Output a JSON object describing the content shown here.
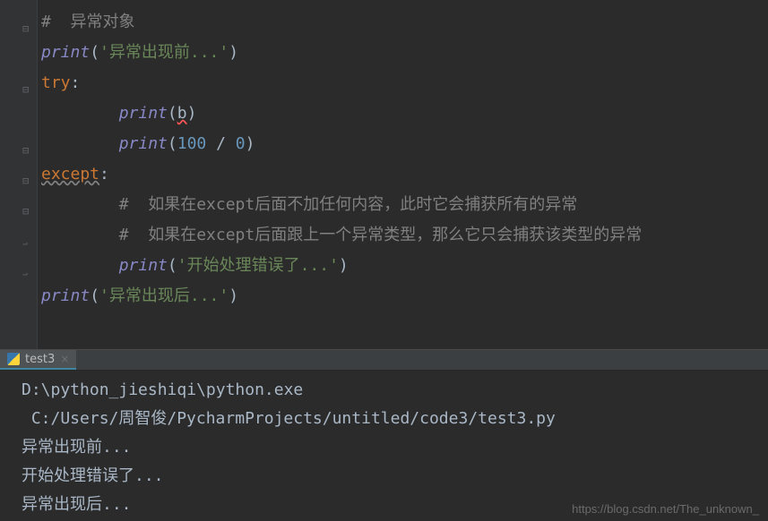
{
  "editor": {
    "lines": [
      {
        "gutter": "minus",
        "segments": [
          {
            "cls": "c-comment",
            "text": "#  异常对象"
          }
        ]
      },
      {
        "gutter": "",
        "segments": [
          {
            "cls": "c-builtin",
            "text": "print"
          },
          {
            "cls": "c-paren",
            "text": "("
          },
          {
            "cls": "c-string",
            "text": "'异常出现前...'"
          },
          {
            "cls": "c-paren",
            "text": ")"
          }
        ]
      },
      {
        "gutter": "minus",
        "segments": [
          {
            "cls": "c-keyword",
            "text": "try"
          },
          {
            "cls": "c-op",
            "text": ":"
          }
        ]
      },
      {
        "gutter": "",
        "indent": 2,
        "segments": [
          {
            "cls": "c-builtin",
            "text": "print"
          },
          {
            "cls": "c-paren",
            "text": "("
          },
          {
            "cls": "c-ident-err",
            "text": "b"
          },
          {
            "cls": "c-paren",
            "text": ")"
          }
        ]
      },
      {
        "gutter": "minus",
        "indent": 2,
        "segments": [
          {
            "cls": "c-builtin",
            "text": "print"
          },
          {
            "cls": "c-paren",
            "text": "("
          },
          {
            "cls": "c-number",
            "text": "100 "
          },
          {
            "cls": "c-op",
            "text": "/ "
          },
          {
            "cls": "c-number",
            "text": "0"
          },
          {
            "cls": "c-paren",
            "text": ")"
          }
        ]
      },
      {
        "gutter": "minus",
        "segments": [
          {
            "cls": "c-except",
            "text": "except"
          },
          {
            "cls": "c-op",
            "text": ":"
          }
        ]
      },
      {
        "gutter": "minus",
        "indent": 2,
        "segments": [
          {
            "cls": "c-comment",
            "text": "#  如果在except后面不加任何内容，此时它会捕获所有的异常"
          }
        ]
      },
      {
        "gutter": "end",
        "indent": 2,
        "segments": [
          {
            "cls": "c-comment",
            "text": "#  如果在except后面跟上一个异常类型，那么它只会捕获该类型的异常"
          }
        ]
      },
      {
        "gutter": "end",
        "indent": 2,
        "segments": [
          {
            "cls": "c-builtin",
            "text": "print"
          },
          {
            "cls": "c-paren",
            "text": "("
          },
          {
            "cls": "c-string",
            "text": "'开始处理错误了...'"
          },
          {
            "cls": "c-paren",
            "text": ")"
          }
        ]
      },
      {
        "gutter": "",
        "segments": [
          {
            "cls": "c-builtin",
            "text": "print"
          },
          {
            "cls": "c-paren",
            "text": "("
          },
          {
            "cls": "c-string",
            "text": "'异常出现后...'"
          },
          {
            "cls": "c-paren",
            "text": ")"
          }
        ]
      }
    ]
  },
  "run": {
    "tab": {
      "label": "test3"
    },
    "output": [
      "D:\\python_jieshiqi\\python.exe",
      " C:/Users/周智俊/PycharmProjects/untitled/code3/test3.py",
      "异常出现前...",
      "开始处理错误了...",
      "异常出现后..."
    ]
  },
  "watermark": "https://blog.csdn.net/The_unknown_"
}
